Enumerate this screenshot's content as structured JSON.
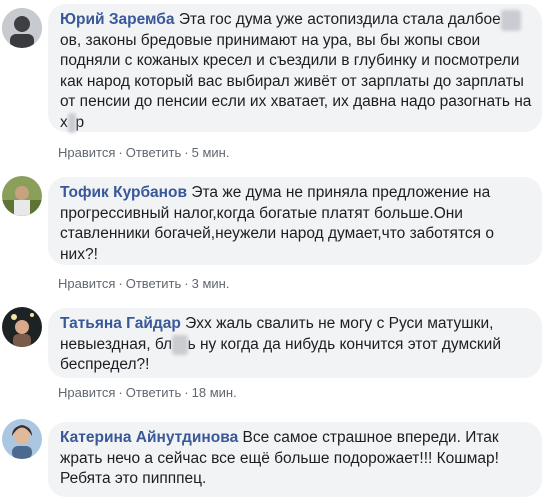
{
  "comments": [
    {
      "author": "Юрий Заремба",
      "text_parts": [
        "Эта гос дума уже астопиздила стала далбое",
        "бы",
        "ов, законы бредовые принимают на ура, вы бы жопы свои подняли с кожаных кресел и съездили в глубинку и посмотрели как народ который вас выбирал живёт от зарплаты до зарплаты от пенсии до пенсии если их хватает, их давна надо разогнать на х",
        "у",
        "р"
      ],
      "like_label": "Нравится",
      "reply_label": "Ответить",
      "time": "5 мин."
    },
    {
      "author": "Тофик Курбанов",
      "text": "Эта же дума не приняла предложение на прогрессивный налог,когда богатые платят больше.Они ставленники богачей,неужели народ думает,что заботятся о них?!",
      "like_label": "Нравится",
      "reply_label": "Ответить",
      "time": "3 мин."
    },
    {
      "author": "Татьяна Гайдар",
      "text_parts": [
        "Эхх жаль свалить не могу с Руси матушки, невыездная, бл",
        "ят",
        "ь ну когда да нибудь кончится этот думский беспредел?!"
      ],
      "like_label": "Нравится",
      "reply_label": "Ответить",
      "time": "18 мин."
    },
    {
      "author": "Катерина Айнутдинова",
      "text": "Все самое страшное впереди. Итак жрать нечо а сейчас все ещё больше подорожает!!! Кошмар! Ребята это пипппец."
    }
  ],
  "colors": {
    "author": "#385898",
    "bubble": "#f2f3f5",
    "meta": "#606770",
    "text": "#1c1e21"
  }
}
